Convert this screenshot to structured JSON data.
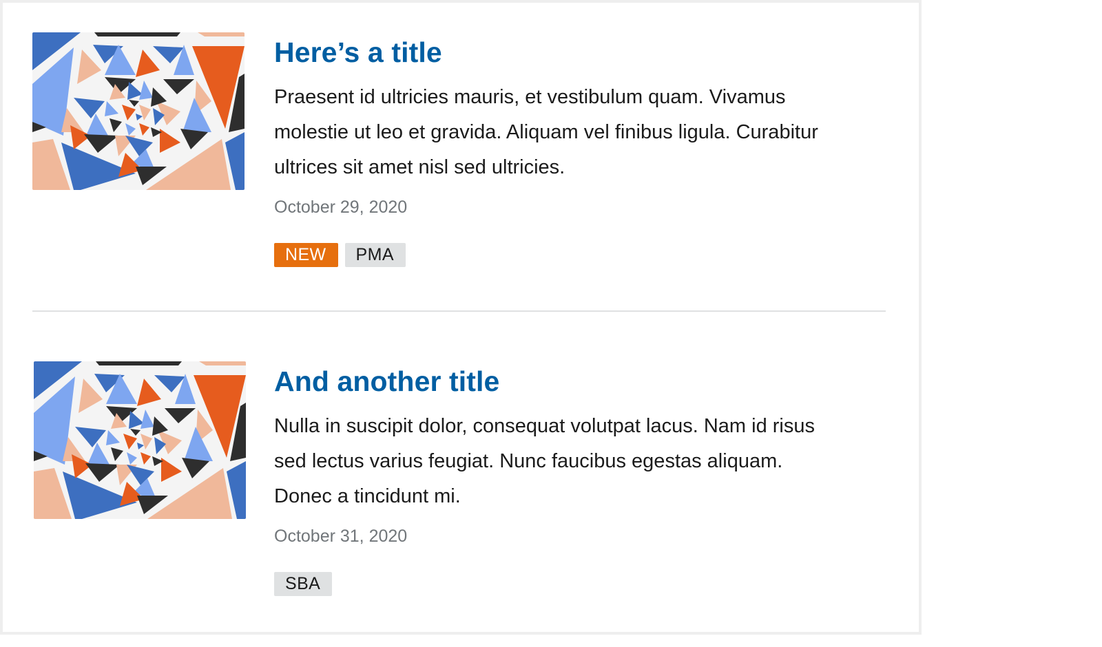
{
  "items": [
    {
      "title": "Here’s a title",
      "description": "Praesent id ultricies mauris, et vestibulum quam. Vivamus molestie ut leo et gravida. Aliquam vel finibus ligula. Curabitur ultrices sit amet nisl sed ultricies.",
      "date": "October 29, 2020",
      "tags": [
        {
          "label": "NEW",
          "style": "accent",
          "color": "#e66f0e"
        },
        {
          "label": "PMA",
          "style": "neutral",
          "color": "#dfe1e2"
        }
      ]
    },
    {
      "title": "And another title",
      "description": "Nulla in suscipit dolor, consequat volutpat lacus. Nam id risus sed lectus varius feugiat. Nunc faucibus egestas aliquam. Donec a tincidunt mi.",
      "date": "October 31, 2020",
      "tags": [
        {
          "label": "SBA",
          "style": "neutral",
          "color": "#dfe1e2"
        }
      ]
    }
  ],
  "colors": {
    "title": "#005ea2",
    "text": "#1b1b1b",
    "date": "#71767a",
    "divider": "#dfe1e2",
    "border": "#eeeeee",
    "thumb_palette": [
      "#3d6fc0",
      "#7ea6f0",
      "#f0b89a",
      "#e65c1e",
      "#2e2e2e",
      "#f4f4f4"
    ]
  }
}
